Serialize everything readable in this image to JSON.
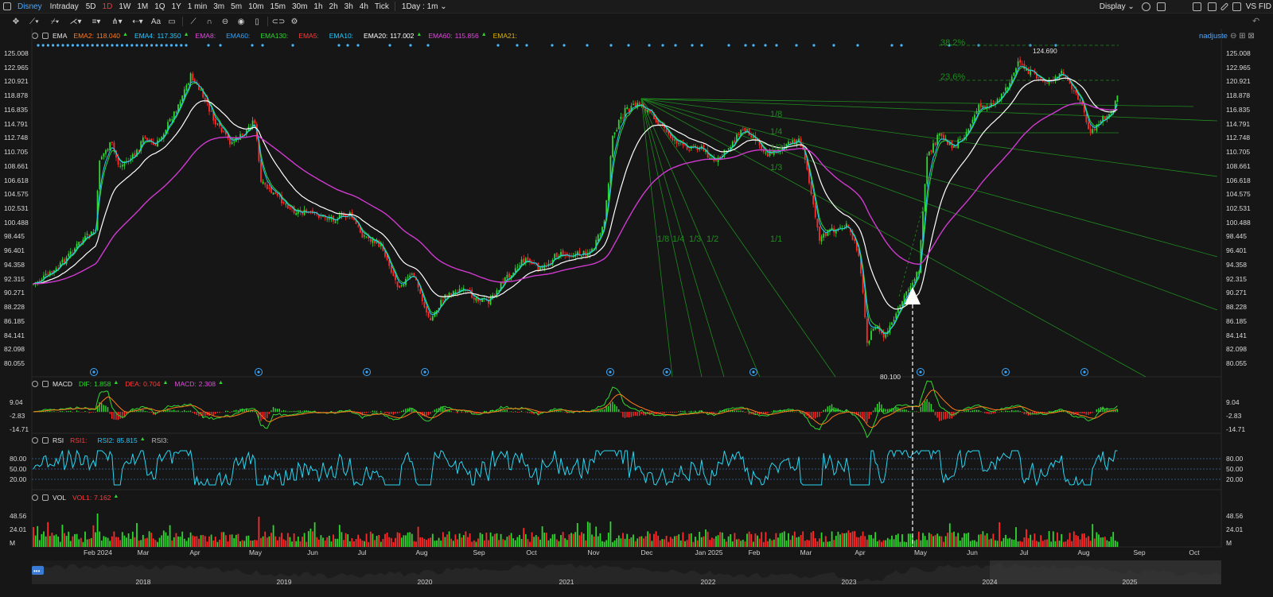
{
  "topbar": {
    "symbol": "Disney",
    "intraday": "Intraday",
    "periods": [
      "5D",
      "1D",
      "1W",
      "1M",
      "1Q",
      "1Y",
      "1 min",
      "3m",
      "5m",
      "10m",
      "15m",
      "30m",
      "1h",
      "2h",
      "3h",
      "4h",
      "Tick"
    ],
    "active_period": "1D",
    "interval": "1Day : 1m",
    "display": "Display",
    "vsfid": "VS FID"
  },
  "ema_legend": {
    "name": "EMA",
    "items": [
      {
        "k": "EMA2:",
        "v": "118.040",
        "c": "#ff7a1a"
      },
      {
        "k": "EMA4:",
        "v": "117.350",
        "c": "#27c9ff"
      },
      {
        "k": "EMA8:",
        "v": "",
        "c": "#e14adf"
      },
      {
        "k": "EMA60:",
        "v": "",
        "c": "#33a2ff"
      },
      {
        "k": "EMA130:",
        "v": "",
        "c": "#2fd72f"
      },
      {
        "k": "EMA5:",
        "v": "",
        "c": "#ff3b3b"
      },
      {
        "k": "EMA10:",
        "v": "",
        "c": "#27c9ff"
      },
      {
        "k": "EMA20:",
        "v": "117.002",
        "c": "#ffffff"
      },
      {
        "k": "EMA60:",
        "v": "115.856",
        "c": "#e14adf"
      },
      {
        "k": "EMA21:",
        "v": "",
        "c": "#e0b400"
      }
    ]
  },
  "sync_label": "nadjuste",
  "price_axis": [
    "125.008",
    "122.965",
    "120.921",
    "118.878",
    "116.835",
    "114.791",
    "112.748",
    "110.705",
    "108.661",
    "106.618",
    "104.575",
    "102.531",
    "100.488",
    "98.445",
    "96.401",
    "94.358",
    "92.315",
    "90.271",
    "88.228",
    "86.185",
    "84.141",
    "82.098",
    "80.055"
  ],
  "high_label": "124.690",
  "low_label": "80.100",
  "fib_labels": [
    {
      "t": "1/8"
    },
    {
      "t": "1/4"
    },
    {
      "t": "1/3"
    },
    {
      "t": "1/3"
    },
    {
      "t": "1/8"
    },
    {
      "t": "1/4"
    },
    {
      "t": "1/3"
    },
    {
      "t": "1/2"
    },
    {
      "t": "1/1"
    },
    {
      "t": "23.6%"
    },
    {
      "t": "38.2%"
    }
  ],
  "macd_legend": {
    "name": "MACD",
    "items": [
      {
        "k": "DIF:",
        "v": "1.858",
        "c": "#2fd72f"
      },
      {
        "k": "DEA:",
        "v": "0.704",
        "c": "#ff3b3b"
      },
      {
        "k": "MACD:",
        "v": "2.308",
        "c": "#e14adf"
      }
    ]
  },
  "macd_axis": [
    "9.04",
    "-2.83",
    "-14.71"
  ],
  "rsi_legend": {
    "name": "RSI",
    "items": [
      {
        "k": "RSI1:",
        "v": "",
        "c": "#ff3b3b"
      },
      {
        "k": "RSI2:",
        "v": "85.815",
        "c": "#27c9ff"
      },
      {
        "k": "RSI3:",
        "v": "",
        "c": "#bdbdbd"
      }
    ]
  },
  "rsi_axis": [
    "80.00",
    "50.00",
    "20.00"
  ],
  "vol_legend": {
    "name": "VOL",
    "items": [
      {
        "k": "VOL1:",
        "v": "7.162",
        "c": "#ff3b3b"
      }
    ]
  },
  "vol_axis": [
    "48.56",
    "24.01",
    "M"
  ],
  "months": [
    "Feb 2024",
    "Mar",
    "Apr",
    "May",
    "Jun",
    "Jul",
    "Aug",
    "Sep",
    "Oct",
    "Nov",
    "Dec",
    "Jan 2025",
    "Feb",
    "Mar",
    "Apr",
    "May",
    "Jun",
    "Jul",
    "Aug",
    "Sep",
    "Oct"
  ],
  "years": [
    "2018",
    "2019",
    "2020",
    "2021",
    "2022",
    "2023",
    "2024",
    "2025"
  ],
  "colors": {
    "up": "#2fd72f",
    "down": "#ff2b2b",
    "ema20": "#ffffff",
    "ema60": "#d03ad0",
    "fast": "#27c9ff",
    "rsi": "#2bd5ef",
    "fib": "#1f8a1f"
  }
}
